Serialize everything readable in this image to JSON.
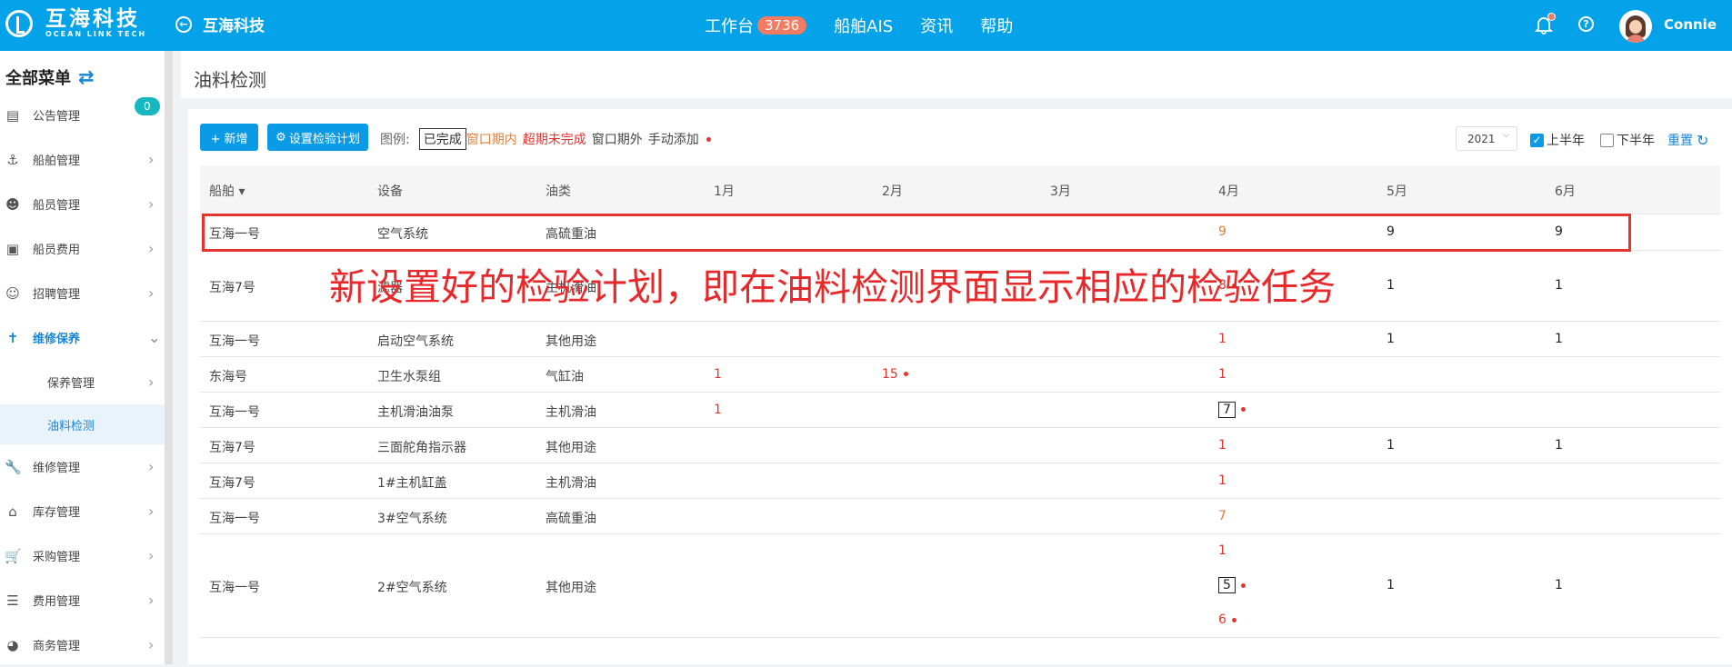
{
  "header": {
    "logo_cn": "互海科技",
    "logo_en": "OCEAN LINK TECH",
    "back_label": "互海科技",
    "nav": [
      {
        "label": "工作台",
        "badge": "3736"
      },
      {
        "label": "船舶AIS"
      },
      {
        "label": "资讯"
      },
      {
        "label": "帮助"
      }
    ],
    "username": "Connie"
  },
  "sidebar": {
    "title": "全部菜单",
    "items": [
      {
        "label": "公告管理",
        "icon": "book-icon",
        "badge": "0"
      },
      {
        "label": "船舶管理",
        "icon": "anchor-icon"
      },
      {
        "label": "船员管理",
        "icon": "person-icon"
      },
      {
        "label": "船员费用",
        "icon": "wallet-icon"
      },
      {
        "label": "招聘管理",
        "icon": "recruit-icon"
      },
      {
        "label": "维修保养",
        "icon": "tool-icon"
      },
      {
        "label": "保养管理"
      },
      {
        "label": "油料检测"
      },
      {
        "label": "维修管理",
        "icon": "wrench-icon"
      },
      {
        "label": "库存管理",
        "icon": "home-icon"
      },
      {
        "label": "采购管理",
        "icon": "cart-icon"
      },
      {
        "label": "费用管理",
        "icon": "coins-icon"
      },
      {
        "label": "商务管理",
        "icon": "globe-icon"
      }
    ]
  },
  "page": {
    "title": "油料检测",
    "add_button": "+ 新增",
    "plan_button": "设置检验计划",
    "legend_label": "图例:",
    "legend": [
      "已完成",
      "窗口期内",
      "超期未完成",
      "窗口期外",
      "手动添加"
    ],
    "year": "2021",
    "first_half": "上半年",
    "second_half": "下半年",
    "reset": "重置"
  },
  "colors": {
    "primary": "#04a2e8",
    "orange": "#e0803a",
    "red": "#e5342e"
  },
  "table": {
    "headers": [
      "船舶",
      "设备",
      "油类",
      "1月",
      "2月",
      "3月",
      "4月",
      "5月",
      "6月"
    ],
    "rows": [
      {
        "ship": "互海一号",
        "device": "空气系统",
        "oil": "高硫重油",
        "apr": [
          {
            "t": "9",
            "c": "orange"
          }
        ],
        "may": [
          {
            "t": "9",
            "c": "black"
          }
        ],
        "jun": [
          {
            "t": "9",
            "c": "black"
          }
        ]
      },
      {
        "ship": "互海7号",
        "device": "滤器",
        "oil": "主机滑油",
        "apr": [
          {
            "t": "8",
            "c": "red",
            "dot": true
          }
        ],
        "may": [
          {
            "t": "1",
            "c": "black"
          }
        ],
        "jun": [
          {
            "t": "1",
            "c": "black"
          }
        ]
      },
      {
        "ship": "互海一号",
        "device": "启动空气系统",
        "oil": "其他用途",
        "apr": [
          {
            "t": "1",
            "c": "red"
          }
        ],
        "may": [
          {
            "t": "1",
            "c": "black"
          }
        ],
        "jun": [
          {
            "t": "1",
            "c": "black"
          }
        ]
      },
      {
        "ship": "东海号",
        "device": "卫生水泵组",
        "oil": "气缸油",
        "jan": [
          {
            "t": "1",
            "c": "red"
          }
        ],
        "feb": [
          {
            "t": "15",
            "c": "red",
            "dot": true
          }
        ],
        "apr": [
          {
            "t": "1",
            "c": "red"
          }
        ]
      },
      {
        "ship": "互海一号",
        "device": "主机滑油油泵",
        "oil": "主机滑油",
        "jan": [
          {
            "t": "1",
            "c": "red"
          }
        ],
        "apr": [
          {
            "t": "7",
            "c": "black",
            "box": true,
            "dot": true
          }
        ]
      },
      {
        "ship": "互海7号",
        "device": "三面舵角指示器",
        "oil": "其他用途",
        "apr": [
          {
            "t": "1",
            "c": "red"
          }
        ],
        "may": [
          {
            "t": "1",
            "c": "black"
          }
        ],
        "jun": [
          {
            "t": "1",
            "c": "black"
          }
        ]
      },
      {
        "ship": "互海7号",
        "device": "1#主机缸盖",
        "oil": "主机滑油",
        "apr": [
          {
            "t": "1",
            "c": "red"
          }
        ]
      },
      {
        "ship": "互海一号",
        "device": "3#空气系统",
        "oil": "高硫重油",
        "apr": [
          {
            "t": "7",
            "c": "orange"
          }
        ]
      },
      {
        "ship": "互海一号",
        "device": "2#空气系统",
        "oil": "其他用途",
        "apr": [
          {
            "t": "1",
            "c": "red"
          },
          {
            "t": "5",
            "c": "black",
            "box": true,
            "dot": true
          },
          {
            "t": "6",
            "c": "red",
            "dot": true
          }
        ],
        "may": [
          {
            "t": "1",
            "c": "black"
          }
        ],
        "jun": [
          {
            "t": "1",
            "c": "black"
          }
        ]
      }
    ]
  },
  "annotation": "新设置好的检验计划，即在油料检测界面显示相应的检验任务"
}
